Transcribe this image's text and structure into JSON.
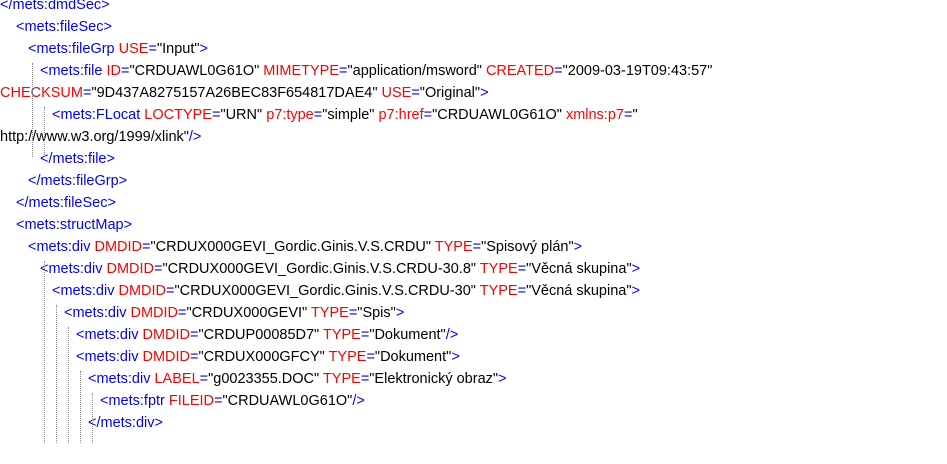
{
  "viewer": {
    "lines": [
      {
        "indent": 0,
        "parts": [
          {
            "t": "tag",
            "v": "</mets:dmdSec>"
          }
        ]
      },
      {
        "indent": 1,
        "parts": [
          {
            "t": "tag",
            "v": "<mets:fileSec>"
          }
        ]
      },
      {
        "indent": 2,
        "parts": [
          {
            "t": "tag",
            "v": "<mets:fileGrp "
          },
          {
            "t": "an",
            "v": "USE"
          },
          {
            "t": "tag",
            "v": "="
          },
          {
            "t": "av",
            "v": "\"Input\""
          },
          {
            "t": "tag",
            "v": ">"
          }
        ]
      },
      {
        "indent": 3,
        "parts": [
          {
            "t": "tag",
            "v": "<mets:file "
          },
          {
            "t": "an",
            "v": "ID"
          },
          {
            "t": "tag",
            "v": "="
          },
          {
            "t": "av",
            "v": "\"CRDUAWL0G61O\" "
          },
          {
            "t": "an",
            "v": "MIMETYPE"
          },
          {
            "t": "tag",
            "v": "="
          },
          {
            "t": "av",
            "v": "\"application/msword\" "
          },
          {
            "t": "an",
            "v": "CREATED"
          },
          {
            "t": "tag",
            "v": "="
          },
          {
            "t": "av",
            "v": "\"2009-03-19T09:43:57\""
          }
        ]
      },
      {
        "indent": 0,
        "parts": [
          {
            "t": "an",
            "v": "CHECKSUM"
          },
          {
            "t": "tag",
            "v": "="
          },
          {
            "t": "av",
            "v": "\"9D437A8275157A26BEC83F654817DAE4\" "
          },
          {
            "t": "an",
            "v": "USE"
          },
          {
            "t": "tag",
            "v": "="
          },
          {
            "t": "av",
            "v": "\"Original\""
          },
          {
            "t": "tag",
            "v": ">"
          }
        ]
      },
      {
        "indent": 4,
        "parts": [
          {
            "t": "tag",
            "v": "<mets:FLocat "
          },
          {
            "t": "an",
            "v": "LOCTYPE"
          },
          {
            "t": "tag",
            "v": "="
          },
          {
            "t": "av",
            "v": "\"URN\" "
          },
          {
            "t": "an",
            "v": "p7:type"
          },
          {
            "t": "tag",
            "v": "="
          },
          {
            "t": "av",
            "v": "\"simple\" "
          },
          {
            "t": "an",
            "v": "p7:href"
          },
          {
            "t": "tag",
            "v": "="
          },
          {
            "t": "av",
            "v": "\"CRDUAWL0G61O\" "
          },
          {
            "t": "an",
            "v": "xmlns:p7"
          },
          {
            "t": "tag",
            "v": "="
          },
          {
            "t": "av",
            "v": "\""
          }
        ]
      },
      {
        "indent": 0,
        "parts": [
          {
            "t": "av",
            "v": "http://www.w3.org/1999/xlink\""
          },
          {
            "t": "tag",
            "v": "/>"
          }
        ]
      },
      {
        "indent": 3,
        "parts": [
          {
            "t": "tag",
            "v": "</mets:file>"
          }
        ]
      },
      {
        "indent": 2,
        "parts": [
          {
            "t": "tag",
            "v": "</mets:fileGrp>"
          }
        ]
      },
      {
        "indent": 1,
        "parts": [
          {
            "t": "tag",
            "v": "</mets:fileSec>"
          }
        ]
      },
      {
        "indent": 1,
        "parts": [
          {
            "t": "tag",
            "v": "<mets:structMap>"
          }
        ]
      },
      {
        "indent": 2,
        "parts": [
          {
            "t": "tag",
            "v": "<mets:div "
          },
          {
            "t": "an",
            "v": "DMDID"
          },
          {
            "t": "tag",
            "v": "="
          },
          {
            "t": "av",
            "v": "\"CRDUX000GEVI_Gordic.Ginis.V.S.CRDU\" "
          },
          {
            "t": "an",
            "v": "TYPE"
          },
          {
            "t": "tag",
            "v": "="
          },
          {
            "t": "av",
            "v": "\"Spisový plán\""
          },
          {
            "t": "tag",
            "v": ">"
          }
        ]
      },
      {
        "indent": 3,
        "parts": [
          {
            "t": "tag",
            "v": "<mets:div "
          },
          {
            "t": "an",
            "v": "DMDID"
          },
          {
            "t": "tag",
            "v": "="
          },
          {
            "t": "av",
            "v": "\"CRDUX000GEVI_Gordic.Ginis.V.S.CRDU-30.8\" "
          },
          {
            "t": "an",
            "v": "TYPE"
          },
          {
            "t": "tag",
            "v": "="
          },
          {
            "t": "av",
            "v": "\"Věcná skupina\""
          },
          {
            "t": "tag",
            "v": ">"
          }
        ]
      },
      {
        "indent": 4,
        "parts": [
          {
            "t": "tag",
            "v": "<mets:div "
          },
          {
            "t": "an",
            "v": "DMDID"
          },
          {
            "t": "tag",
            "v": "="
          },
          {
            "t": "av",
            "v": "\"CRDUX000GEVI_Gordic.Ginis.V.S.CRDU-30\" "
          },
          {
            "t": "an",
            "v": "TYPE"
          },
          {
            "t": "tag",
            "v": "="
          },
          {
            "t": "av",
            "v": "\"Věcná skupina\""
          },
          {
            "t": "tag",
            "v": ">"
          }
        ]
      },
      {
        "indent": 5,
        "parts": [
          {
            "t": "tag",
            "v": "<mets:div "
          },
          {
            "t": "an",
            "v": "DMDID"
          },
          {
            "t": "tag",
            "v": "="
          },
          {
            "t": "av",
            "v": "\"CRDUX000GEVI\" "
          },
          {
            "t": "an",
            "v": "TYPE"
          },
          {
            "t": "tag",
            "v": "="
          },
          {
            "t": "av",
            "v": "\"Spis\""
          },
          {
            "t": "tag",
            "v": ">"
          }
        ]
      },
      {
        "indent": 6,
        "parts": [
          {
            "t": "tag",
            "v": "<mets:div "
          },
          {
            "t": "an",
            "v": "DMDID"
          },
          {
            "t": "tag",
            "v": "="
          },
          {
            "t": "av",
            "v": "\"CRDUP00085D7\" "
          },
          {
            "t": "an",
            "v": "TYPE"
          },
          {
            "t": "tag",
            "v": "="
          },
          {
            "t": "av",
            "v": "\"Dokument\""
          },
          {
            "t": "tag",
            "v": "/>"
          }
        ]
      },
      {
        "indent": 6,
        "parts": [
          {
            "t": "tag",
            "v": "<mets:div "
          },
          {
            "t": "an",
            "v": "DMDID"
          },
          {
            "t": "tag",
            "v": "="
          },
          {
            "t": "av",
            "v": "\"CRDUX000GFCY\" "
          },
          {
            "t": "an",
            "v": "TYPE"
          },
          {
            "t": "tag",
            "v": "="
          },
          {
            "t": "av",
            "v": "\"Dokument\""
          },
          {
            "t": "tag",
            "v": ">"
          }
        ]
      },
      {
        "indent": 7,
        "parts": [
          {
            "t": "tag",
            "v": "<mets:div "
          },
          {
            "t": "an",
            "v": "LABEL"
          },
          {
            "t": "tag",
            "v": "="
          },
          {
            "t": "av",
            "v": "\"g0023355.DOC\" "
          },
          {
            "t": "an",
            "v": "TYPE"
          },
          {
            "t": "tag",
            "v": "="
          },
          {
            "t": "av",
            "v": "\"Elektronický obraz\""
          },
          {
            "t": "tag",
            "v": ">"
          }
        ]
      },
      {
        "indent": 8,
        "parts": [
          {
            "t": "tag",
            "v": "<mets:fptr "
          },
          {
            "t": "an",
            "v": "FILEID"
          },
          {
            "t": "tag",
            "v": "="
          },
          {
            "t": "av",
            "v": "\"CRDUAWL0G61O\""
          },
          {
            "t": "tag",
            "v": "/>"
          }
        ]
      },
      {
        "indent": 7,
        "parts": [
          {
            "t": "tag",
            "v": "</mets:div>"
          }
        ]
      }
    ]
  },
  "colors": {
    "tag": "#0000ff",
    "attr_name": "#ff0000",
    "attr_value": "#000000",
    "guide": "#8a8a8a",
    "background": "#ffffff"
  }
}
